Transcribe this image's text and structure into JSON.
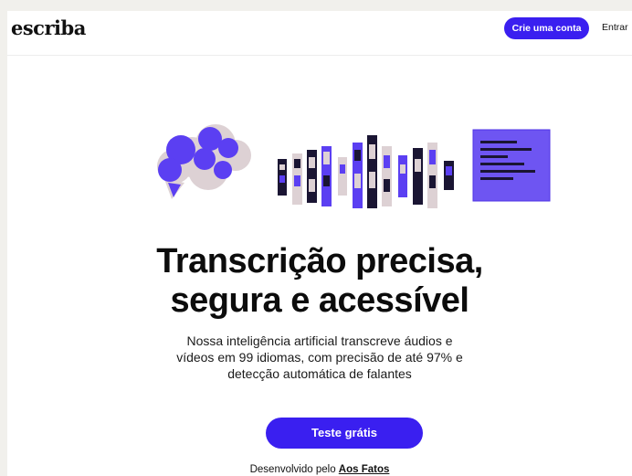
{
  "header": {
    "logo": "escriba",
    "signup_button": "Crie uma conta",
    "login_link": "Entrar"
  },
  "hero": {
    "title_line1": "Transcrição precisa,",
    "title_line2": "segura e acessível",
    "subtitle_line1": "Nossa inteligência artificial transcreve áudios e",
    "subtitle_line2": "vídeos em 99 idiomas, com precisão de até 97% e",
    "subtitle_line3": "detecção automática de falantes",
    "cta_button": "Teste grátis"
  },
  "footer": {
    "credit_prefix": "Desenvolvido pelo",
    "credit_link": "Aos Fatos"
  },
  "colors": {
    "accent": "#3a1ff0",
    "illustration_purple": "#5b3ff2",
    "illustration_pink": "#ddd1d4",
    "page_bg": "#f1f0ec"
  },
  "icons": [
    "speech-cloud-icon",
    "audio-wave-icon",
    "transcript-document-icon"
  ]
}
